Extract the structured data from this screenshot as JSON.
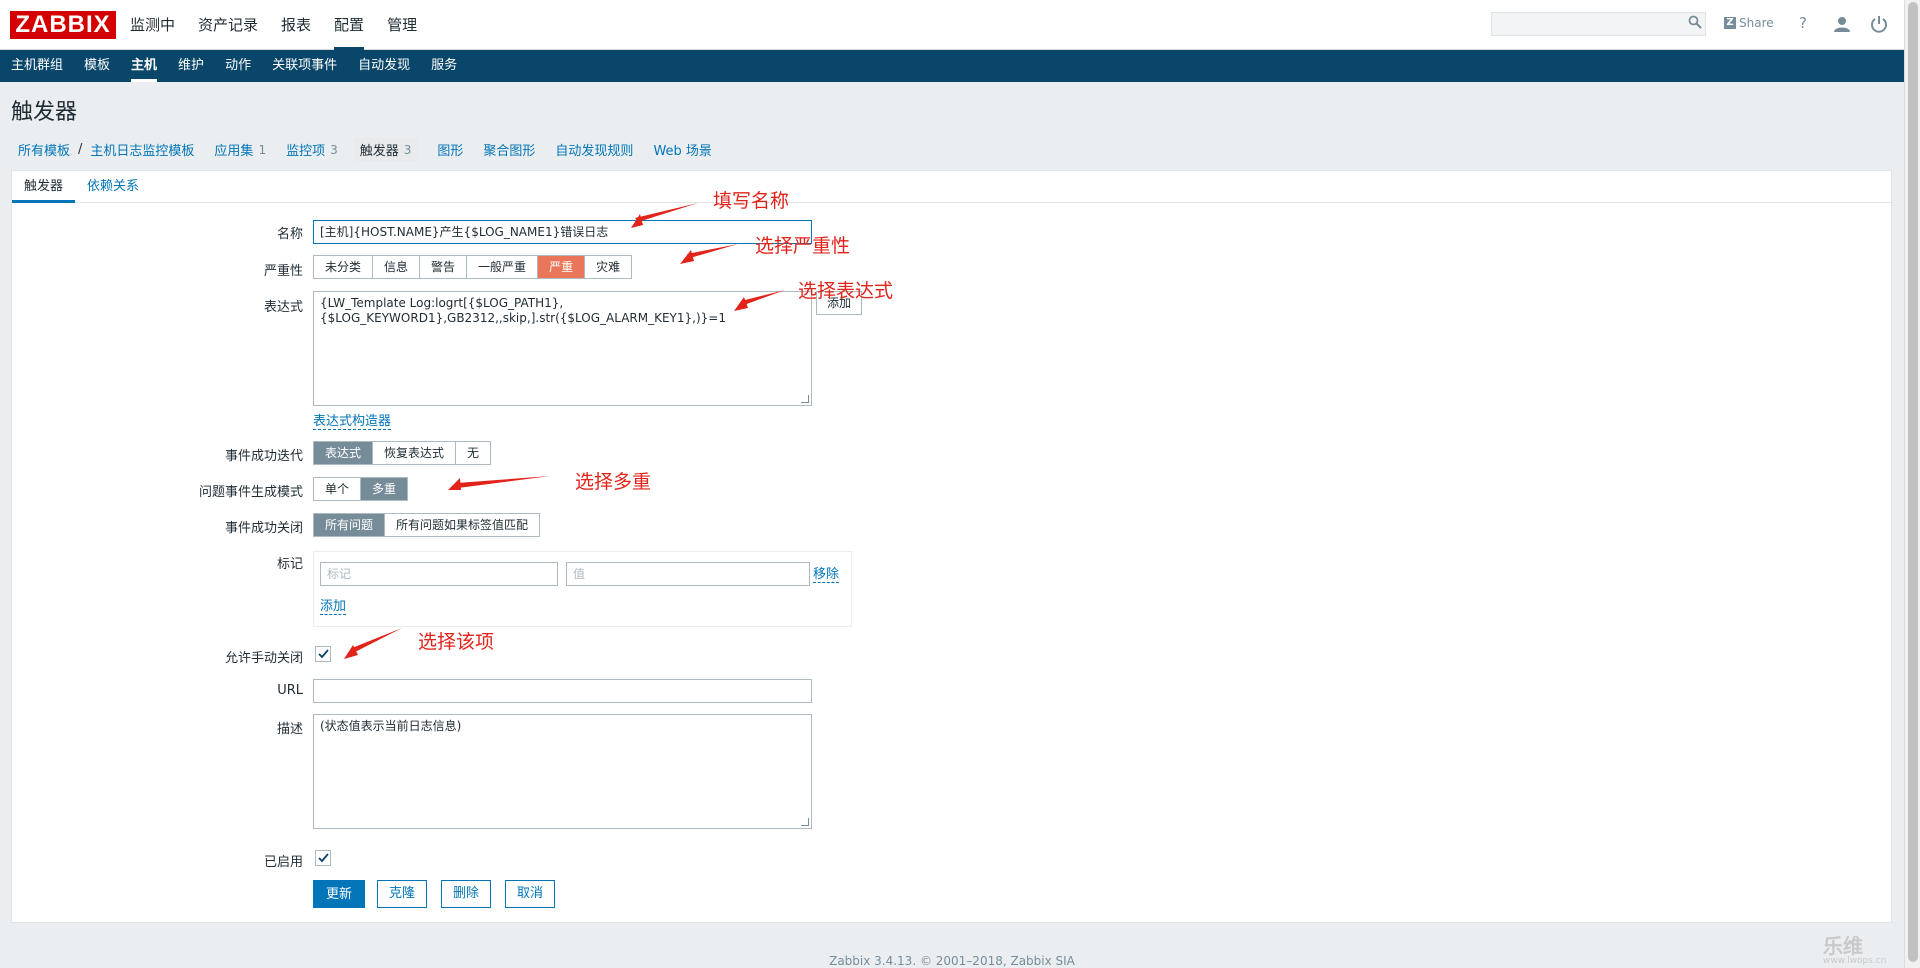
{
  "logo": "ZABBIX",
  "main_menu": [
    {
      "label": "监测中"
    },
    {
      "label": "资产记录"
    },
    {
      "label": "报表"
    },
    {
      "label": "配置",
      "active": true
    },
    {
      "label": "管理"
    }
  ],
  "topbar": {
    "share_label": "Share",
    "help_label": "?"
  },
  "sub_menu": [
    {
      "label": "主机群组"
    },
    {
      "label": "模板"
    },
    {
      "label": "主机",
      "active": true
    },
    {
      "label": "维护"
    },
    {
      "label": "动作"
    },
    {
      "label": "关联项事件"
    },
    {
      "label": "自动发现"
    },
    {
      "label": "服务"
    }
  ],
  "page_title": "触发器",
  "breadcrumb": {
    "all_templates": "所有模板",
    "template": "主机日志监控模板",
    "nav": [
      {
        "label": "应用集",
        "count": "1"
      },
      {
        "label": "监控项",
        "count": "3"
      },
      {
        "label": "触发器",
        "count": "3",
        "selected": true
      },
      {
        "label": "图形",
        "count": ""
      },
      {
        "label": "聚合图形",
        "count": ""
      },
      {
        "label": "自动发现规则",
        "count": ""
      },
      {
        "label": "Web 场景",
        "count": ""
      }
    ]
  },
  "tabs": [
    {
      "label": "触发器",
      "active": true
    },
    {
      "label": "依赖关系"
    }
  ],
  "form": {
    "name_label": "名称",
    "name_value": "[主机]{HOST.NAME}产生{$LOG_NAME1}错误日志",
    "severity_label": "严重性",
    "severity_options": [
      "未分类",
      "信息",
      "警告",
      "一般严重",
      "严重",
      "灾难"
    ],
    "severity_selected": "严重",
    "expression_label": "表达式",
    "expression_line1": "{LW_Template Log:logrt[{$LOG_PATH1},",
    "expression_line2": "{$LOG_KEYWORD1},GB2312,,skip,].str({$LOG_ALARM_KEY1},)}=1",
    "expression_add": "添加",
    "expression_builder": "表达式构造器",
    "ok_event_label": "事件成功迭代",
    "ok_event_options": [
      "表达式",
      "恢复表达式",
      "无"
    ],
    "ok_event_selected": "表达式",
    "problem_mode_label": "问题事件生成模式",
    "problem_mode_options": [
      "单个",
      "多重"
    ],
    "problem_mode_selected": "多重",
    "ok_close_label": "事件成功关闭",
    "ok_close_options": [
      "所有问题",
      "所有问题如果标签值匹配"
    ],
    "ok_close_selected": "所有问题",
    "tags_label": "标记",
    "tag_placeholder": "标记",
    "value_placeholder": "值",
    "tag_remove": "移除",
    "tag_add": "添加",
    "manual_close_label": "允许手动关闭",
    "manual_close_checked": true,
    "url_label": "URL",
    "url_value": "",
    "description_label": "描述",
    "description_value": "(状态值表示当前日志信息)",
    "enabled_label": "已启用",
    "enabled_checked": true
  },
  "buttons": {
    "update": "更新",
    "clone": "克隆",
    "delete": "删除",
    "cancel": "取消"
  },
  "annotations": {
    "name": "填写名称",
    "severity": "选择严重性",
    "expression": "选择表达式",
    "multiple": "选择多重",
    "manual_close": "选择该项"
  },
  "footer": "Zabbix 3.4.13. © 2001–2018, Zabbix SIA",
  "watermark": {
    "brand": "乐维",
    "url": "www.lwops.cn"
  },
  "colors": {
    "header_blue": "#0a466a",
    "link_blue": "#0275b8",
    "severity_high": "#e97659",
    "annotation_red": "#e2231a",
    "logo_red": "#d40000"
  }
}
